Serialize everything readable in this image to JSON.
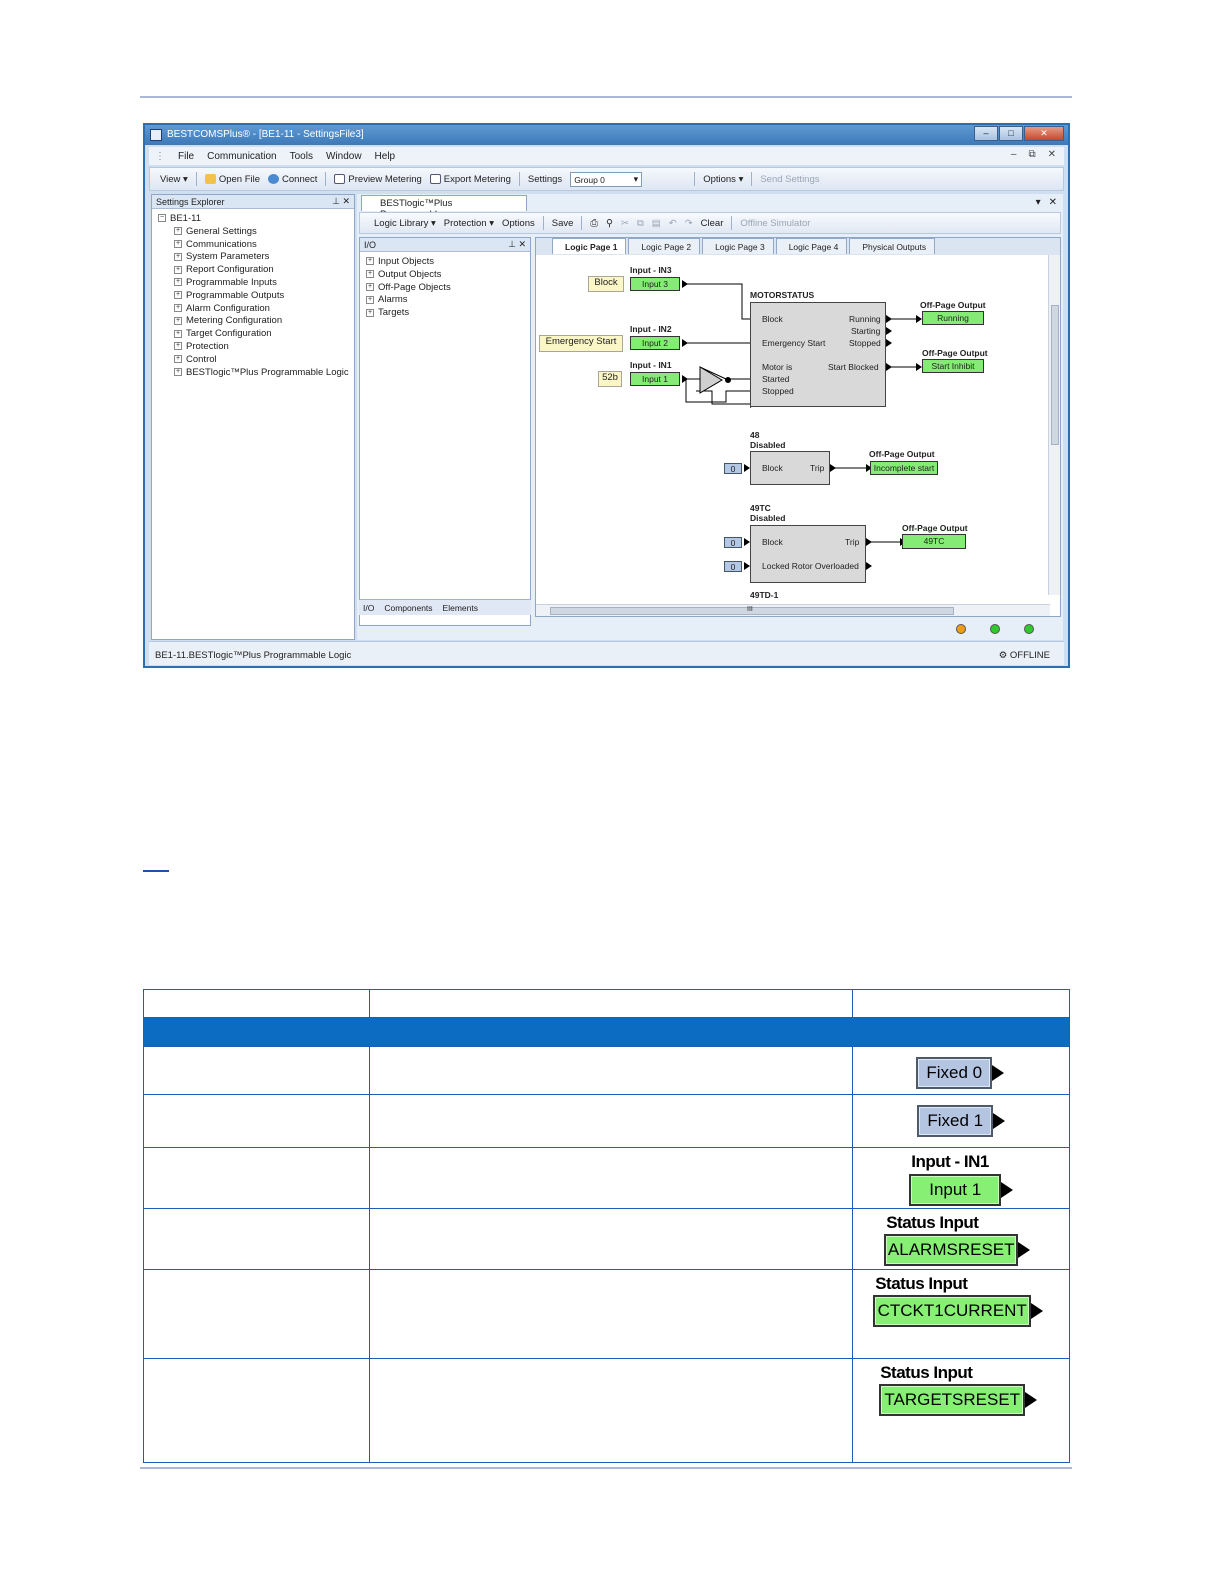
{
  "window": {
    "title": "BESTCOMSPlus® - [BE1-11 - SettingsFile3]",
    "menu": [
      "File",
      "Communication",
      "Tools",
      "Window",
      "Help"
    ],
    "mdi_controls": [
      "–",
      "⧉",
      "✕"
    ]
  },
  "toolbar": {
    "view": "View ▾",
    "open_file": "Open File",
    "connect": "Connect",
    "preview_metering": "Preview Metering",
    "export_metering": "Export Metering",
    "settings": "Settings",
    "group": "Group 0",
    "options": "Options ▾",
    "send_settings": "Send Settings"
  },
  "settings_explorer": {
    "title": "Settings Explorer",
    "root": "BE1-11",
    "items": [
      "General Settings",
      "Communications",
      "System Parameters",
      "Report Configuration",
      "Programmable Inputs",
      "Programmable Outputs",
      "Alarm Configuration",
      "Metering Configuration",
      "Target Configuration",
      "Protection",
      "Control",
      "BESTlogic™Plus Programmable Logic"
    ]
  },
  "logic_doc": {
    "tab_title": "BESTlogic™Plus Programmabl...",
    "toolbar": {
      "logic_library": "Logic Library ▾",
      "protection": "Protection ▾",
      "options": "Options",
      "save": "Save",
      "clear": "Clear",
      "offline_simulator": "Offline Simulator"
    },
    "io_panel": {
      "title": "I/O",
      "items": [
        "Input Objects",
        "Output Objects",
        "Off-Page Objects",
        "Alarms",
        "Targets"
      ],
      "tabs": [
        "I/O",
        "Components",
        "Elements"
      ]
    },
    "page_tabs": [
      "Logic Page 1",
      "Logic Page 2",
      "Logic Page 3",
      "Logic Page 4",
      "Physical Outputs"
    ]
  },
  "diagram": {
    "block_label": "Block",
    "input_in3_title": "Input - IN3",
    "input_3": "Input 3",
    "emergency_label": "Emergency Start",
    "input_in2_title": "Input - IN2",
    "input_2": "Input 2",
    "label_52b": "52b",
    "input_in1_title": "Input - IN1",
    "input_1": "Input 1",
    "motor_title": "MOTORSTATUS",
    "motor_inputs": [
      "Block",
      "Emergency Start",
      "Motor is",
      "Started",
      "Stopped"
    ],
    "motor_outputs": [
      "Running",
      "Starting",
      "Stopped",
      "Start Blocked"
    ],
    "offpage_title": "Off-Page Output",
    "out_running": "Running",
    "out_start_inhibit": "Start Inhibit",
    "b48_title1": "48",
    "b48_title2": "Disabled",
    "zero": "0",
    "block": "Block",
    "trip": "Trip",
    "out_incomplete": "Incomplete start",
    "b49_title1": "49TC",
    "b49_title2": "Disabled",
    "locked_rotor": "Locked Rotor Overloaded",
    "out_49tc": "49TC",
    "partial_label": "49TD-1",
    "hscroll_mark": "III"
  },
  "status_bar": {
    "path": "BE1-11.BESTlogic™Plus Programmable Logic",
    "state": "OFFLINE"
  },
  "table": {
    "rows": [
      {
        "symbol_text": "Fixed 0",
        "kind": "fixed"
      },
      {
        "symbol_text": "Fixed 1",
        "kind": "fixed"
      },
      {
        "title": "Input - IN1",
        "symbol_text": "Input 1",
        "kind": "input"
      },
      {
        "title": "Status Input",
        "symbol_text": "ALARMSRESET",
        "kind": "status"
      },
      {
        "title": "Status Input",
        "symbol_text": "CTCKT1CURRENT",
        "kind": "status"
      },
      {
        "title": "Status Input",
        "symbol_text": "TARGETSRESET",
        "kind": "status"
      }
    ]
  }
}
